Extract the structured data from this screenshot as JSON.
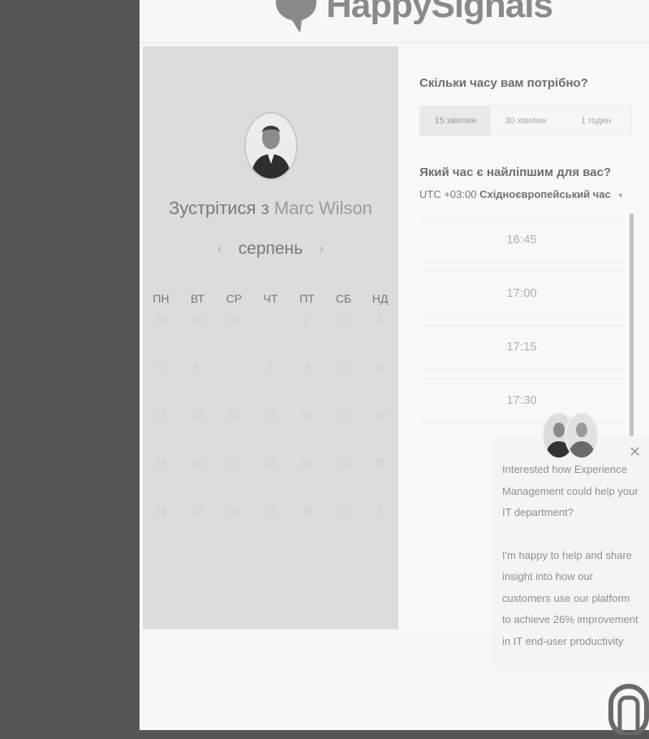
{
  "brand": {
    "logo_text": "HappySignals"
  },
  "host": {
    "title_prefix": "Зустрітися з",
    "name": "Marc Wilson"
  },
  "calendar": {
    "month": "серпень",
    "weekdays": [
      "ПН",
      "ВТ",
      "СР",
      "ЧТ",
      "ПТ",
      "СБ",
      "НД"
    ],
    "weeks": [
      [
        "29",
        "30",
        "31",
        "",
        "2",
        "3",
        "4"
      ],
      [
        "5",
        "6",
        "",
        "8",
        "9",
        "10",
        "11"
      ],
      [
        "12",
        "13",
        "14",
        "15",
        "16",
        "17",
        "18"
      ],
      [
        "19",
        "20",
        "21",
        "22",
        "23",
        "24",
        "25"
      ],
      [
        "26",
        "27",
        "28",
        "29",
        "30",
        "31",
        "1"
      ]
    ]
  },
  "booking": {
    "duration_question": "Скільки часу вам потрібно?",
    "durations": [
      "15 хвилин",
      "30 хвилин",
      "1 годин"
    ],
    "selected_duration": "15 хвилин",
    "time_question": "Який час є найліпшим для вас?",
    "timezone_offset": "UTC +03:00",
    "timezone_name": "Східноєвропейський час",
    "slots": [
      "16:45",
      "17:00",
      "17:15",
      "17:30"
    ]
  },
  "chat_popup": {
    "message_1": "Interested how Experience Management could help your IT department?",
    "message_2": "I'm happy to help and share insight into how our customers use our platform to achieve 26% improvement in IT end-user productivity"
  },
  "icons": {
    "logo": "speech-bubble-logo-icon",
    "prev": "chevron-left-icon",
    "next": "chevron-right-icon",
    "dropdown": "caret-down-icon",
    "close": "close-icon",
    "launcher": "chat-launcher-icon"
  }
}
